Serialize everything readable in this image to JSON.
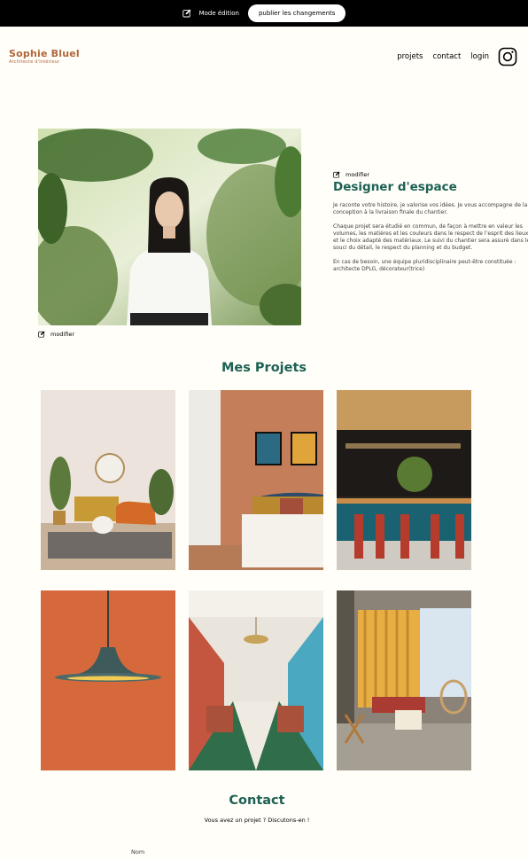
{
  "edit_bar": {
    "mode_label": "Mode édition",
    "publish_label": "publier les changements",
    "icon": "edit-icon"
  },
  "header": {
    "logo_title": "Sophie Bluel",
    "logo_subtitle": "Architecte d'intérieur",
    "nav": {
      "projects": "projets",
      "contact": "contact",
      "login": "login"
    },
    "social_icon": "instagram-icon"
  },
  "introduction": {
    "photo_modify_label": "modifier",
    "text_modify_label": "modifier",
    "title": "Designer d'espace",
    "paragraphs": [
      "Je raconte votre histoire, je valorise vos idées. Je vous accompagne de la conception à la livraison finale du chantier.",
      "Chaque projet sera étudié en commun, de façon à mettre en valeur les volumes, les matières et les couleurs dans le respect de l’esprit des lieux et le choix adapté des matériaux. Le suivi du chantier sera assuré dans le souci du détail, le respect du planning et du budget.",
      "En cas de besoin, une équipe pluridisciplinaire peut-être constituée : architecte DPLG, décorateur(trice)"
    ]
  },
  "portfolio": {
    "title": "Mes Projets",
    "items": [
      {
        "subject": "living-room-photo"
      },
      {
        "subject": "bedroom-photo"
      },
      {
        "subject": "bar-photo"
      },
      {
        "subject": "pendant-lamp-photo"
      },
      {
        "subject": "dining-hall-photo"
      },
      {
        "subject": "patio-lounge-photo"
      }
    ]
  },
  "contact": {
    "title": "Contact",
    "subtitle": "Vous avez un projet ? Discutons-en !",
    "name_label": "Nom"
  },
  "colors": {
    "brand_green": "#1D6154",
    "logo_orange": "#B1663C",
    "background": "#FFFEF8",
    "edit_bar": "#000000"
  }
}
